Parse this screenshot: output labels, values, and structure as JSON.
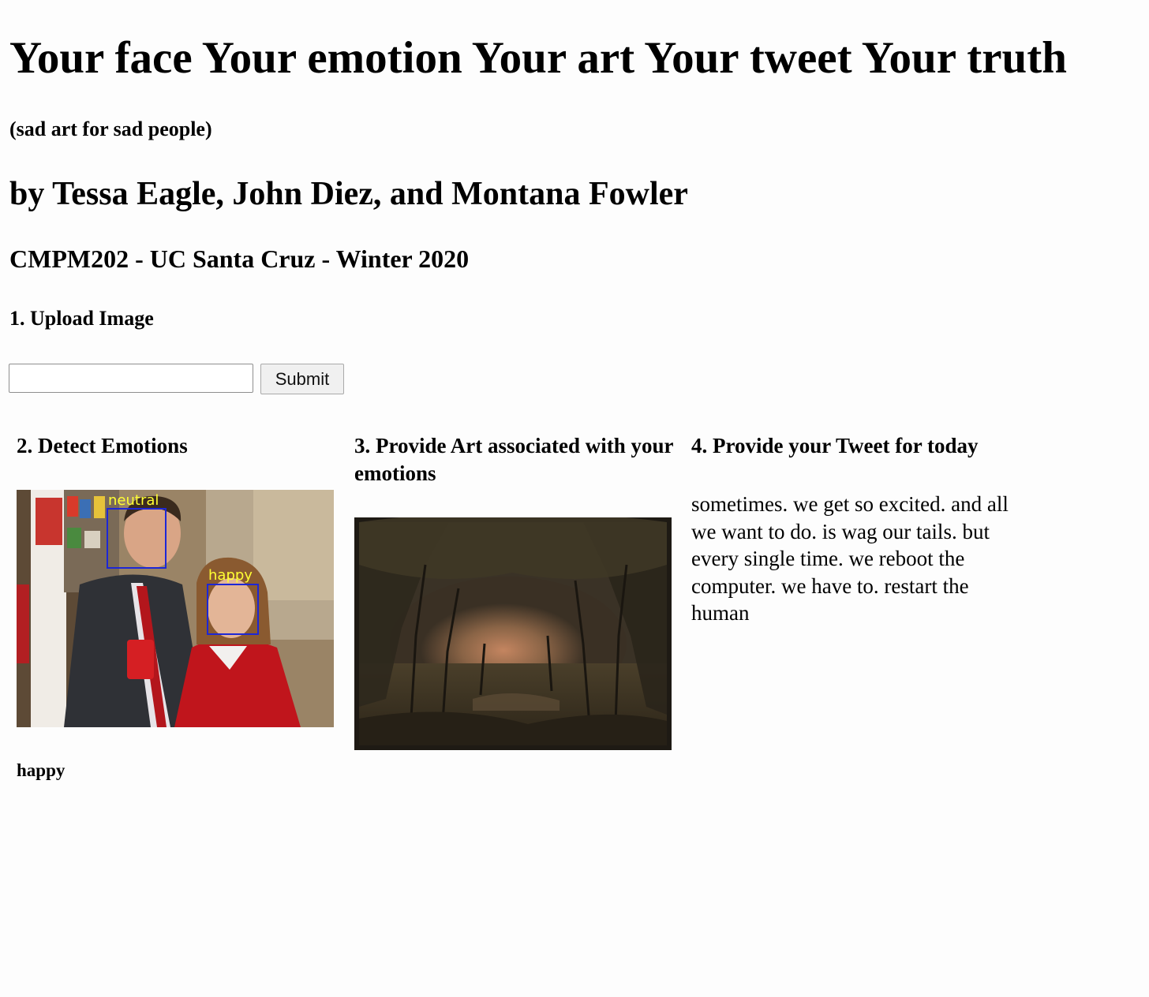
{
  "header": {
    "title": "Your face Your emotion Your art Your tweet Your truth",
    "subtitle": "(sad art for sad people)",
    "authors": "by Tessa Eagle, John Diez, and Montana Fowler",
    "course": "CMPM202 - UC Santa Cruz - Winter 2020"
  },
  "upload": {
    "heading": "1. Upload Image",
    "input_value": "",
    "submit_label": "Submit"
  },
  "detect": {
    "heading": "2. Detect Emotions",
    "faces": [
      {
        "label": "neutral"
      },
      {
        "label": "happy"
      }
    ],
    "result": "happy"
  },
  "art": {
    "heading": "3. Provide Art associated with your emotions"
  },
  "tweet": {
    "heading": "4. Provide your Tweet for today",
    "text": "sometimes. we get so excited. and all we want to do. is wag our tails. but every single time. we reboot the computer. we have to. restart the human"
  }
}
